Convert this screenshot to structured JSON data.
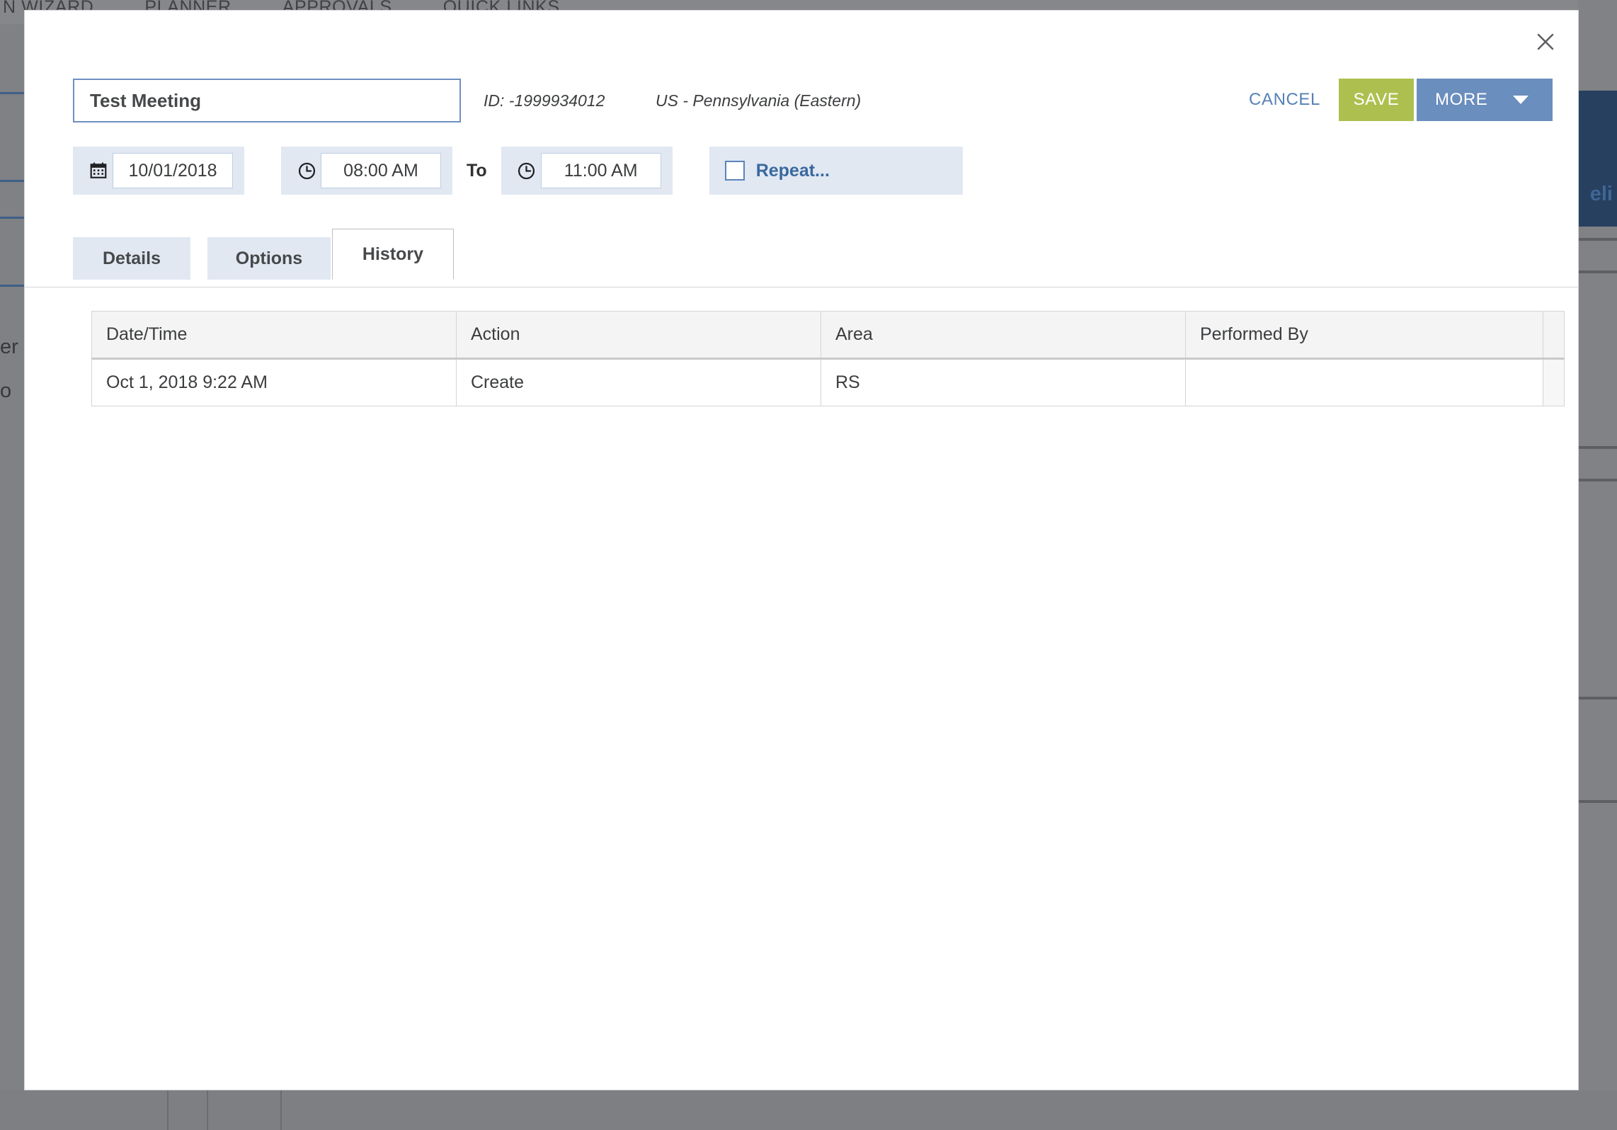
{
  "background": {
    "menu_items": [
      "N WIZARD",
      "PLANNER",
      "APPROVALS",
      "QUICK LINKS"
    ],
    "left_fragments": [
      "er",
      "o"
    ],
    "right_fragment": "eli",
    "overlay_color": "#808286"
  },
  "dialog": {
    "close_icon": "close-icon",
    "title_value": "Test Meeting",
    "title_placeholder": "Title",
    "meta_id": "ID: -1999934012",
    "meta_timezone": "US - Pennsylvania (Eastern)",
    "actions": {
      "cancel_label": "CANCEL",
      "save_label": "SAVE",
      "more_label": "MORE",
      "save_color": "#adc04f",
      "more_color": "#6a8ebd",
      "cancel_color": "#5681b5"
    },
    "schedule": {
      "calendar_icon": "calendar-icon",
      "date_value": "10/01/2018",
      "start_clock_icon": "clock-icon",
      "start_time_value": "08:00 AM",
      "to_label": "To",
      "end_clock_icon": "clock-icon",
      "end_time_value": "11:00 AM",
      "repeat_label": "Repeat...",
      "repeat_checked": false
    },
    "tabs": [
      {
        "label": "Details",
        "active": false
      },
      {
        "label": "Options",
        "active": false
      },
      {
        "label": "History",
        "active": true
      }
    ],
    "history_table": {
      "columns": [
        "Date/Time",
        "Action",
        "Area",
        "Performed By"
      ],
      "rows": [
        {
          "datetime": "Oct 1, 2018 9:22 AM",
          "action": "Create",
          "area": "RS",
          "performed_by": ""
        }
      ]
    }
  }
}
